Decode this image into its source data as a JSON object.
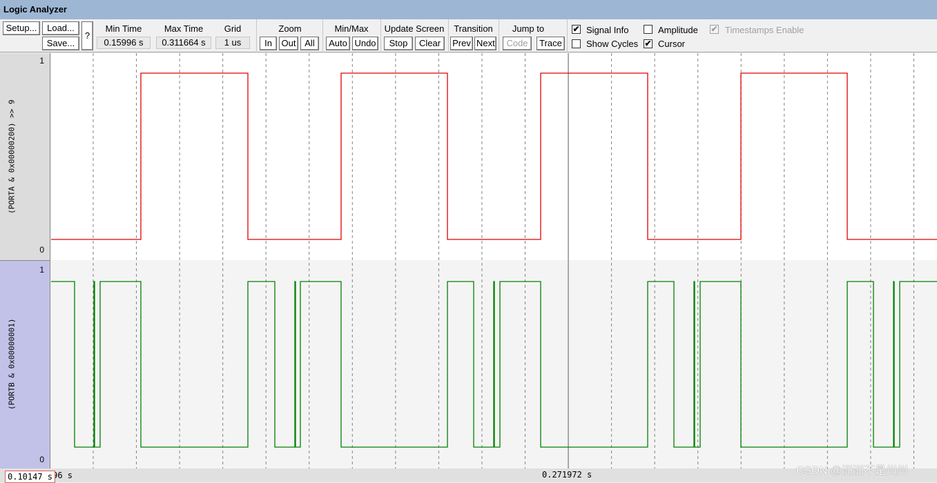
{
  "window": {
    "title": "Logic Analyzer"
  },
  "toolbar": {
    "setup": "Setup...",
    "load": "Load...",
    "save": "Save...",
    "help": "?",
    "min_time_label": "Min Time",
    "min_time": "0.15996 s",
    "max_time_label": "Max Time",
    "max_time": "0.311664 s",
    "grid_label": "Grid",
    "grid": "1 us",
    "zoom_label": "Zoom",
    "zoom_in": "In",
    "zoom_out": "Out",
    "zoom_all": "All",
    "minmax_label": "Min/Max",
    "auto": "Auto",
    "undo": "Undo",
    "update_label": "Update Screen",
    "stop": "Stop",
    "clear": "Clear",
    "transition_label": "Transition",
    "prev": "Prev",
    "next": "Next",
    "jump_label": "Jump to",
    "code": "Code",
    "trace": "Trace",
    "options": {
      "signal_info": {
        "label": "Signal Info",
        "checked": true,
        "enabled": true
      },
      "amplitude": {
        "label": "Amplitude",
        "checked": false,
        "enabled": true
      },
      "timestamps": {
        "label": "Timestamps Enable",
        "checked": true,
        "enabled": false
      },
      "show_cycles": {
        "label": "Show Cycles",
        "checked": false,
        "enabled": true
      },
      "cursor": {
        "label": "Cursor",
        "checked": true,
        "enabled": true
      }
    }
  },
  "signals": [
    {
      "name": "(PORTA & 0x00000200) >> 9",
      "max": "1",
      "min": "0",
      "color": "#e00000",
      "initial": 0,
      "transitions": [
        0.175331,
        0.193658,
        0.209621,
        0.227829,
        0.243792,
        0.262119,
        0.278082,
        0.29629
      ]
    },
    {
      "name": "(PORTB & 0x00000001)",
      "max": "1",
      "min": "0",
      "color": "#008000",
      "initial": 1,
      "transitions": [
        0.16398,
        0.167291,
        0.167409,
        0.168355,
        0.175331,
        0.193658,
        0.19827,
        0.201699,
        0.201817,
        0.202645,
        0.209621,
        0.227829,
        0.232322,
        0.235751,
        0.235869,
        0.236815,
        0.243792,
        0.262119,
        0.266612,
        0.270041,
        0.270159,
        0.271105,
        0.278082,
        0.29629,
        0.300783,
        0.304212,
        0.30433,
        0.305276
      ]
    }
  ],
  "time_axis": {
    "left_label": "0.15996 s",
    "start_box": "0.10147 s",
    "cursor_label": "0.271972 s"
  },
  "colors": {
    "grid": "#808080",
    "cursor": "#909090"
  },
  "watermark": "CSDN @洲洲不是州州"
}
